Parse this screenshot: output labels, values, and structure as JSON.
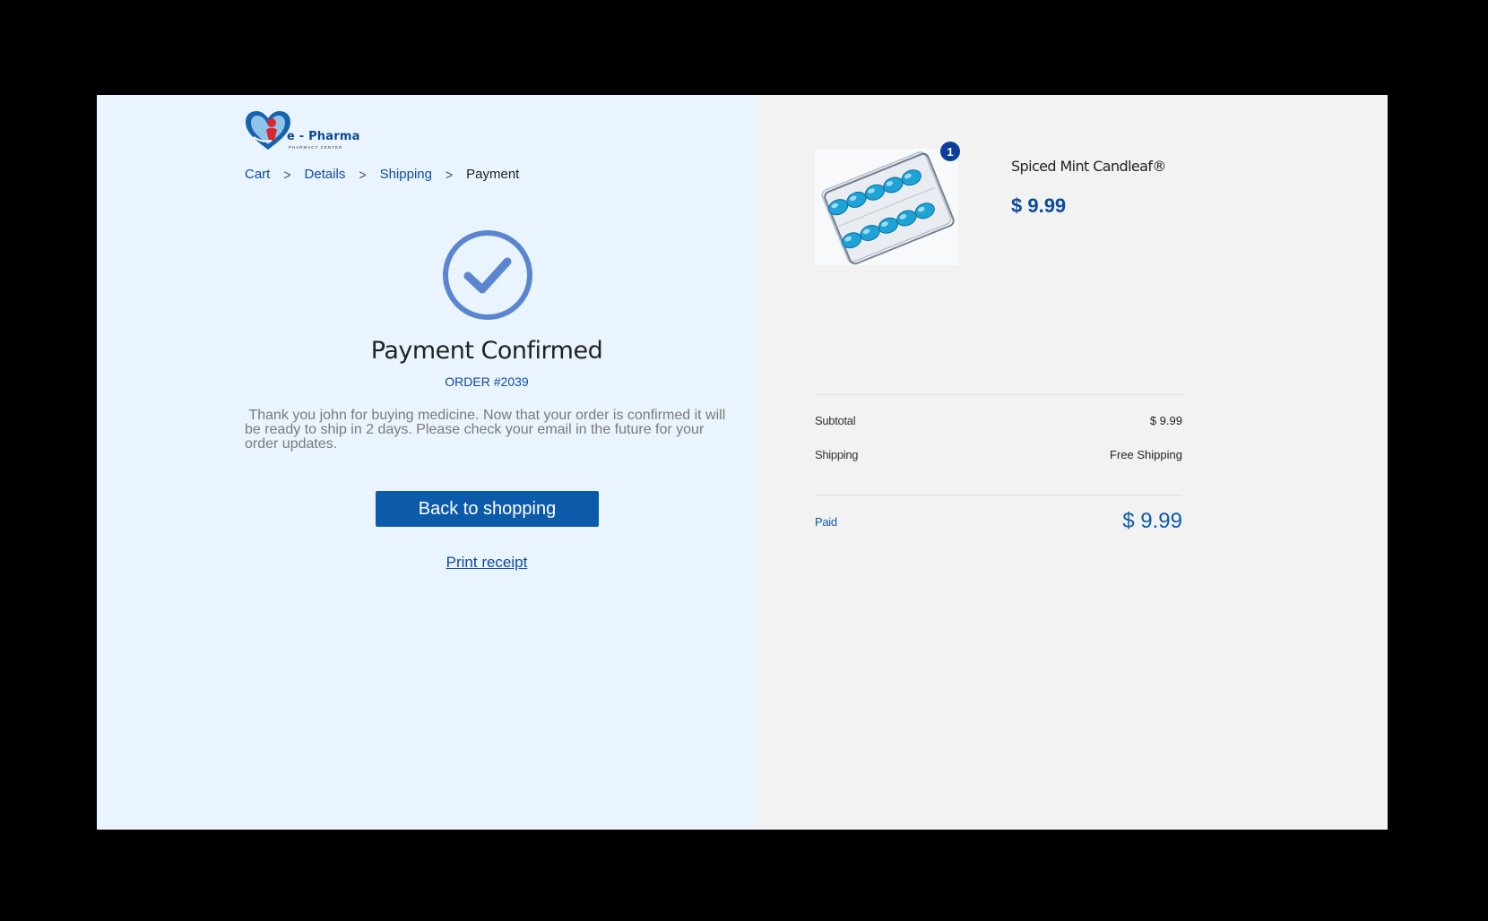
{
  "brand": {
    "name": "e - Pharma",
    "tagline": "PHARMACY CENTER",
    "colors": {
      "primary": "#0c5bab",
      "accent_red": "#d8262f",
      "link": "#0d4a9f"
    }
  },
  "breadcrumb": {
    "items": [
      {
        "label": "Cart",
        "current": false
      },
      {
        "label": "Details",
        "current": false
      },
      {
        "label": "Shipping",
        "current": false
      },
      {
        "label": "Payment",
        "current": true
      }
    ],
    "separator": ">"
  },
  "confirmation": {
    "icon": "check-circle-icon",
    "title": "Payment Confirmed",
    "order_label": "ORDER #2039",
    "message": " Thank you john for buying medicine. Now that your order is confirmed it will be ready to ship in 2 days. Please check your email in the future for your order updates.",
    "back_button": "Back to shopping",
    "print_link": "Print receipt"
  },
  "order_summary": {
    "product": {
      "name": "Spiced Mint Candleaf®",
      "price": "$ 9.99",
      "quantity": "1",
      "image": "blister-pack-capsules"
    },
    "subtotal_label": "Subtotal",
    "subtotal_value": "$ 9.99",
    "shipping_label": "Shipping",
    "shipping_value": "Free Shipping",
    "paid_label": "Paid",
    "paid_value": "$ 9.99"
  }
}
